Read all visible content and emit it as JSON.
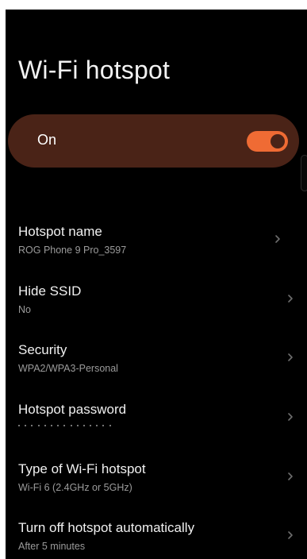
{
  "page": {
    "title": "Wi-Fi hotspot"
  },
  "master_toggle": {
    "label": "On",
    "state": true,
    "on_color": "#ef6b34",
    "card_color": "#4a2317"
  },
  "settings": [
    {
      "title": "Hotspot name",
      "value": "ROG Phone 9 Pro_3597"
    },
    {
      "title": "Hide SSID",
      "value": "No"
    },
    {
      "title": "Security",
      "value": "WPA2/WPA3-Personal"
    },
    {
      "title": "Hotspot password",
      "value": "•••••••••••••••",
      "masked": true
    },
    {
      "title": "Type of Wi-Fi hotspot",
      "value": "Wi-Fi 6 (2.4GHz or 5GHz)"
    },
    {
      "title": "Turn off hotspot automatically",
      "value": "After 5 minutes"
    }
  ],
  "icons": {
    "row_chevron": "chevron-right-icon"
  }
}
